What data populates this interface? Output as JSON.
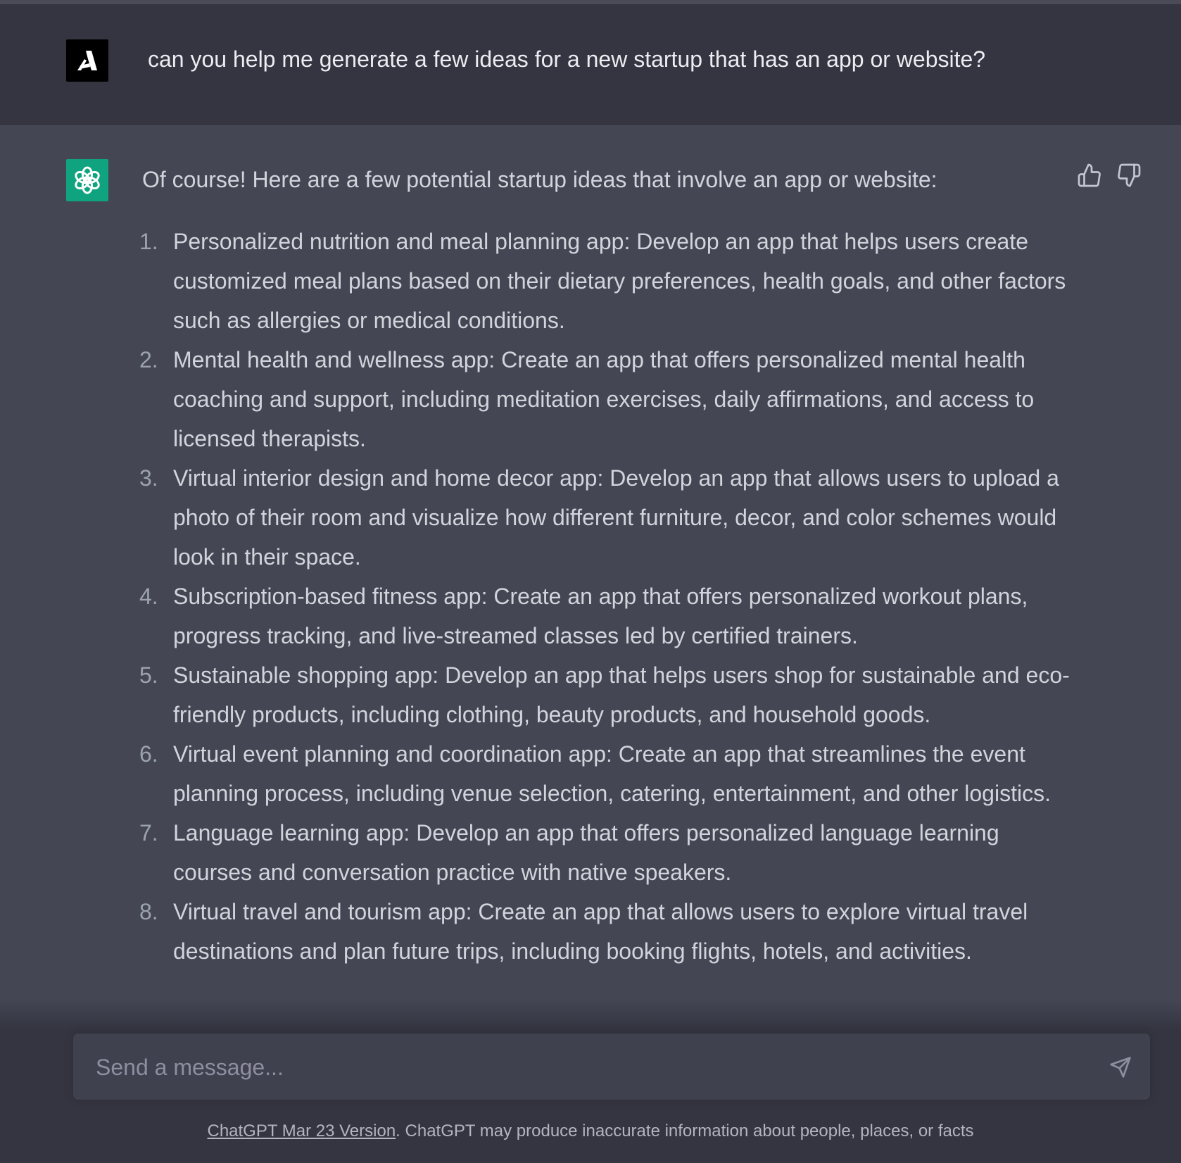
{
  "user_message": {
    "avatar_icon": "logo-a-icon",
    "text": "can you help me generate a few ideas for a new startup that has an app or website?"
  },
  "assistant_message": {
    "avatar_icon": "openai-logo-icon",
    "intro": "Of course! Here are a few potential startup ideas that involve an app or website:",
    "items": [
      {
        "number": "1.",
        "text": "Personalized nutrition and meal planning app: Develop an app that helps users create customized meal plans based on their dietary preferences, health goals, and other factors such as allergies or medical conditions."
      },
      {
        "number": "2.",
        "text": "Mental health and wellness app: Create an app that offers personalized mental health coaching and support, including meditation exercises, daily affirmations, and access to licensed therapists."
      },
      {
        "number": "3.",
        "text": "Virtual interior design and home decor app: Develop an app that allows users to upload a photo of their room and visualize how different furniture, decor, and color schemes would look in their space."
      },
      {
        "number": "4.",
        "text": "Subscription-based fitness app: Create an app that offers personalized workout plans, progress tracking, and live-streamed classes led by certified trainers."
      },
      {
        "number": "5.",
        "text": "Sustainable shopping app: Develop an app that helps users shop for sustainable and eco-friendly products, including clothing, beauty products, and household goods."
      },
      {
        "number": "6.",
        "text": "Virtual event planning and coordination app: Create an app that streamlines the event planning process, including venue selection, catering, entertainment, and other logistics."
      },
      {
        "number": "7.",
        "text": "Language learning app: Develop an app that offers personalized language learning courses and conversation practice with native speakers."
      },
      {
        "number": "8.",
        "text": "Virtual travel and tourism app: Create an app that allows users to explore virtual travel destinations and plan future trips, including booking flights, hotels, and activities."
      }
    ],
    "feedback_icons": [
      "thumbs-up-icon",
      "thumbs-down-icon"
    ]
  },
  "composer": {
    "placeholder": "Send a message...",
    "send_icon": "send-icon"
  },
  "footer": {
    "link_text": "ChatGPT Mar 23 Version",
    "note": ". ChatGPT may produce inaccurate information about people, places, or facts"
  },
  "colors": {
    "page_bg": "#444654",
    "user_row_bg": "#343541",
    "assistant_avatar_bg": "#10a37f",
    "composer_bg": "#40414f",
    "text": "#d1d5db",
    "muted": "#8e8ea0"
  }
}
